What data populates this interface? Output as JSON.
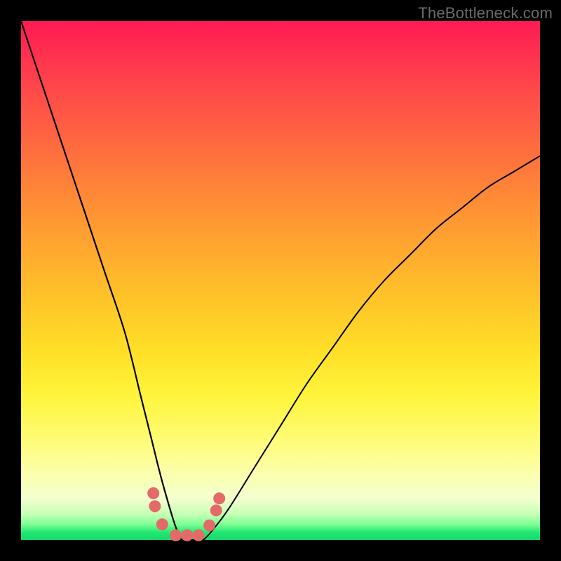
{
  "watermark": {
    "text": "TheBottleneck.com"
  },
  "chart_data": {
    "type": "line",
    "title": "",
    "xlabel": "",
    "ylabel": "",
    "xlim": [
      0,
      100
    ],
    "ylim": [
      0,
      100
    ],
    "grid": false,
    "legend": false,
    "series": [
      {
        "name": "bottleneck-curve",
        "x": [
          0,
          4,
          8,
          12,
          16,
          20,
          23,
          25,
          27,
          29,
          30,
          31,
          33,
          35,
          37,
          40,
          45,
          50,
          55,
          60,
          65,
          70,
          75,
          80,
          85,
          90,
          95,
          100
        ],
        "y": [
          100,
          88,
          76,
          64,
          52,
          40,
          28,
          20,
          12,
          5,
          2,
          0,
          0,
          0,
          2,
          6,
          14,
          22,
          30,
          37,
          44,
          50,
          55,
          60,
          64,
          68,
          71,
          74
        ]
      }
    ],
    "markers": {
      "name": "highlight-dots",
      "color": "#e46a6a",
      "points": [
        {
          "x": 25.5,
          "y": 9.0
        },
        {
          "x": 25.8,
          "y": 6.5
        },
        {
          "x": 27.2,
          "y": 3.0
        },
        {
          "x": 29.8,
          "y": 0.9
        },
        {
          "x": 32.0,
          "y": 0.9
        },
        {
          "x": 34.2,
          "y": 0.9
        },
        {
          "x": 36.3,
          "y": 2.8
        },
        {
          "x": 37.6,
          "y": 5.7
        },
        {
          "x": 38.2,
          "y": 8.0
        }
      ]
    },
    "background_gradient": {
      "top": "#ff1a52",
      "mid": "#ffe028",
      "bottom": "#17d86a"
    }
  }
}
